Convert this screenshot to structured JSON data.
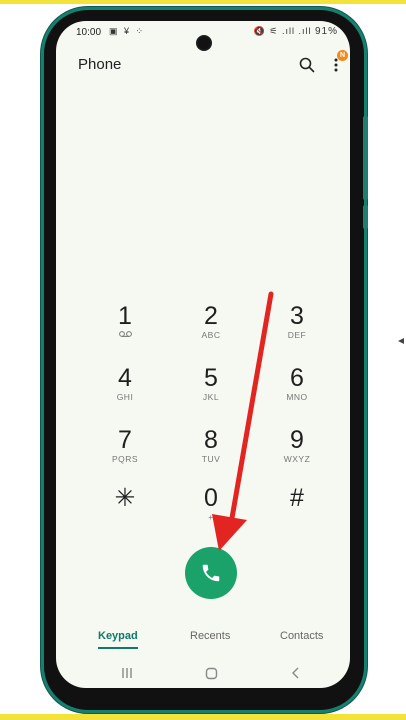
{
  "status_bar": {
    "time": "10:00",
    "left_icons": "▣ ¥ ⁘",
    "right_icons": "🔇 ⚟ .ıll .ıll",
    "battery": "91%"
  },
  "header": {
    "title": "Phone",
    "notification_badge": "N"
  },
  "keypad": [
    {
      "digit": "1",
      "letters": ""
    },
    {
      "digit": "2",
      "letters": "ABC"
    },
    {
      "digit": "3",
      "letters": "DEF"
    },
    {
      "digit": "4",
      "letters": "GHI"
    },
    {
      "digit": "5",
      "letters": "JKL"
    },
    {
      "digit": "6",
      "letters": "MNO"
    },
    {
      "digit": "7",
      "letters": "PQRS"
    },
    {
      "digit": "8",
      "letters": "TUV"
    },
    {
      "digit": "9",
      "letters": "WXYZ"
    },
    {
      "digit": "✳",
      "letters": ""
    },
    {
      "digit": "0",
      "letters": "+"
    },
    {
      "digit": "#",
      "letters": ""
    }
  ],
  "tabs": {
    "keypad": "Keypad",
    "recents": "Recents",
    "contacts": "Contacts"
  },
  "colors": {
    "frame_accent": "#167f6f",
    "call_button": "#1aa26a",
    "active_tab": "#0f7a66",
    "arrow": "#e32522",
    "banner": "#f3e23a"
  }
}
